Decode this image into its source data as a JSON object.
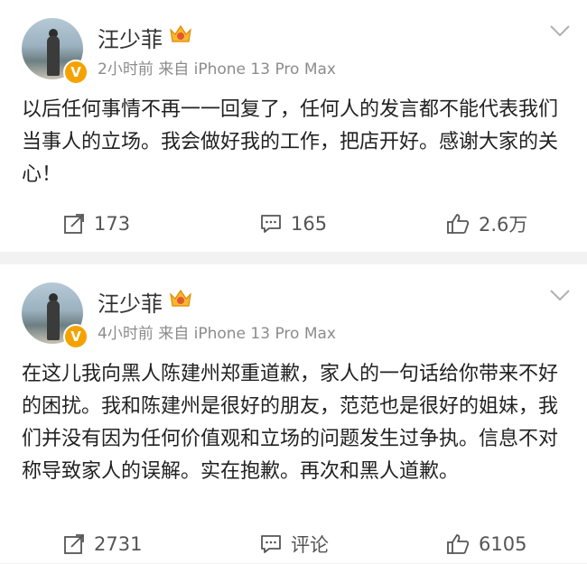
{
  "posts": [
    {
      "author": "汪少菲",
      "meta": "2小时前  来自 iPhone 13 Pro Max",
      "text": "以后任何事情不再一一回复了，任何人的发言都不能代表我们当事人的立场。我会做好我的工作，把店开好。感谢大家的关心！",
      "repost_count": "173",
      "comment_count": "165",
      "like_count": "2.6万"
    },
    {
      "author": "汪少菲",
      "meta": "4小时前  来自 iPhone 13 Pro Max",
      "text": "在这儿我向黑人陈建州郑重道歉，家人的一句话给你带来不好的困扰。我和陈建州是很好的朋友，范范也是很好的姐妹，我们并没有因为任何价值观和立场的问题发生过争执。信息不对称导致家人的误解。实在抱歉。再次和黑人道歉。",
      "repost_count": "2731",
      "comment_count": "评论",
      "like_count": "6105"
    }
  ],
  "colors": {
    "background": "#f2f2f2",
    "card": "#ffffff",
    "text": "#222222",
    "meta": "#8c8c8c",
    "verified_badge": "#f5a200"
  },
  "icons": [
    "verified-v-icon",
    "crown-member-icon",
    "chevron-down-icon",
    "repost-icon",
    "comment-icon",
    "like-icon"
  ]
}
